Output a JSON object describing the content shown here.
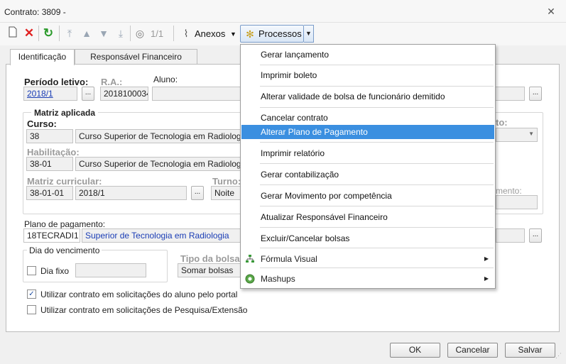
{
  "window": {
    "title": "Contrato: 3809 -"
  },
  "toolbar": {
    "page_counter": "1/1",
    "anexos_label": "Anexos",
    "processos_label": "Processos"
  },
  "tabs": [
    {
      "label": "Identificação"
    },
    {
      "label": "Responsável Financeiro"
    }
  ],
  "form": {
    "periodo_letivo": {
      "label": "Período letivo:",
      "value": "2018/1"
    },
    "ra": {
      "label": "R.A.:",
      "value": "2018100034"
    },
    "aluno": {
      "label": "Aluno:",
      "value": ""
    },
    "matriz_aplicada": {
      "label": "Matriz aplicada"
    },
    "curso": {
      "label": "Curso:",
      "code": "38",
      "name": "Curso Superior de Tecnologia em Radiologia"
    },
    "habilitacao": {
      "label": "Habilitação:",
      "code": "38-01",
      "name": "Curso Superior de Tecnologia em Radiologia"
    },
    "matriz_curricular": {
      "label": "Matriz curricular:",
      "code": "38-01-01",
      "period": "2018/1"
    },
    "turno": {
      "label": "Turno:",
      "value": "Noite"
    },
    "partial_label_1": "to:",
    "partial_label_2": "mento:",
    "plano_pagamento": {
      "label": "Plano de pagamento:",
      "code": "18TECRADI1",
      "name": "Superior de Tecnologia em Radiologia"
    },
    "dia_vencimento": {
      "label": "Dia do vencimento",
      "dia_fixo_label": "Dia fixo",
      "dia_fixo_checked": false,
      "value": ""
    },
    "tipo_bolsa": {
      "label": "Tipo da bolsa:",
      "value": "Somar bolsas"
    },
    "chk_portal": {
      "label": "Utilizar contrato em solicitações do aluno pelo portal",
      "checked": true,
      "mark": "✓"
    },
    "chk_pesquisa": {
      "label": "Utilizar contrato em solicitações de Pesquisa/Extensão",
      "checked": false
    }
  },
  "footer": {
    "ok": "OK",
    "cancelar": "Cancelar",
    "salvar": "Salvar"
  },
  "processos_menu": {
    "items": [
      {
        "label": "Gerar lançamento"
      },
      {
        "label": "Imprimir boleto"
      },
      {
        "label": "Alterar validade de bolsa de funcionário demitido"
      },
      {
        "label": "Cancelar contrato"
      },
      {
        "label": "Alterar Plano de Pagamento",
        "highlighted": true
      },
      {
        "label": "Imprimir relatório"
      },
      {
        "label": "Gerar contabilização"
      },
      {
        "label": "Gerar Movimento por competência"
      },
      {
        "label": "Atualizar Responsável Financeiro"
      },
      {
        "label": "Excluir/Cancelar bolsas"
      },
      {
        "label": "Fórmula Visual",
        "submenu": true
      },
      {
        "label": "Mashups",
        "submenu": true
      }
    ]
  },
  "colors": {
    "highlight": "#3b8fe0",
    "link": "#1a3db5",
    "delete_icon": "#e02020",
    "refresh_icon": "#2a9a2a"
  }
}
